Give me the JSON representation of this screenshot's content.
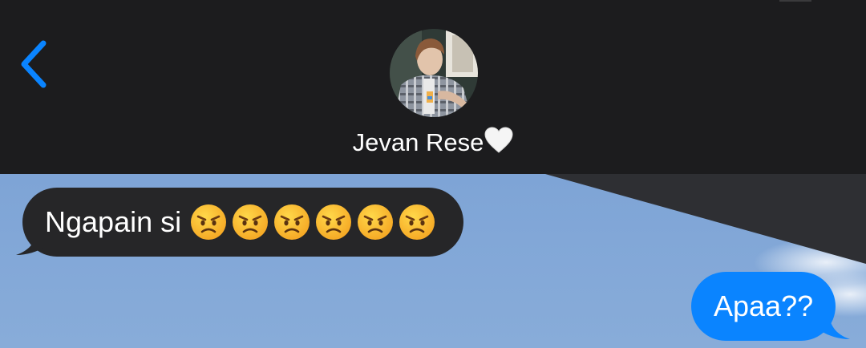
{
  "header": {
    "contact_name": "Jevan Rese",
    "heart_glyph": "🤍",
    "back_icon": "chevron-left-icon",
    "accent_color": "#0a84ff"
  },
  "messages": [
    {
      "direction": "incoming",
      "text": "Ngapain si",
      "emoji": [
        "😠",
        "😠",
        "😠",
        "😠",
        "😠",
        "😠"
      ],
      "emoji_icon": "angry-face-icon",
      "bubble_color": "#262628"
    },
    {
      "direction": "outgoing",
      "text": "Apaa??",
      "bubble_color": "#0a84ff"
    }
  ],
  "colors": {
    "header_bg": "#1c1c1e",
    "text": "#ffffff",
    "wallpaper_sky": "#7fa7d9"
  }
}
